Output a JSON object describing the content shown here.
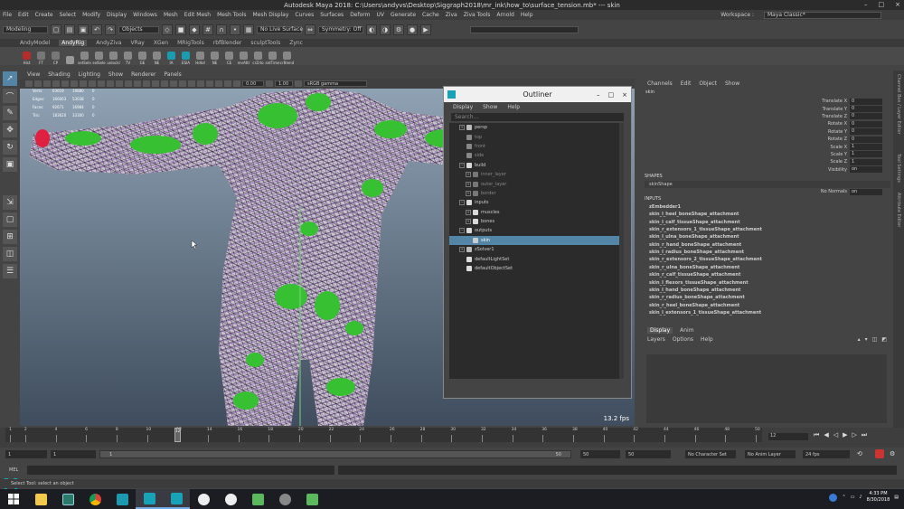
{
  "window": {
    "title": "Autodesk Maya 2018: C:\\Users\\andyvs\\Desktop\\Siggraph2018\\mr_ink\\how_to\\surface_tension.mb*   ---   skin",
    "controls": [
      "–",
      "□",
      "×"
    ]
  },
  "menubar": {
    "items": [
      "File",
      "Edit",
      "Create",
      "Select",
      "Modify",
      "Display",
      "Windows",
      "Mesh",
      "Edit Mesh",
      "Mesh Tools",
      "Mesh Display",
      "Curves",
      "Surfaces",
      "Deform",
      "UV",
      "Generate",
      "Cache",
      "Ziva",
      "Ziva Tools",
      "Arnold",
      "Help"
    ],
    "workspace_label": "Workspace :",
    "workspace_value": "Maya Classic*"
  },
  "statusline": {
    "mode": "Modeling",
    "select_mode": "Objects",
    "live_surface": "No Live Surface",
    "symmetry": "Symmetry: Off"
  },
  "shelf": {
    "tabs": [
      "AndyModel",
      "AndyRig",
      "AndyZiva",
      "VRay",
      "XGen",
      "MRigTools",
      "rbfBlender",
      "sculptTools",
      "Zync"
    ],
    "active": "AndyRig",
    "icons": [
      {
        "label": "Hist",
        "color": "#b32d2d"
      },
      {
        "label": "FT",
        "color": "#777"
      },
      {
        "label": "CP",
        "color": "#777"
      },
      {
        "label": "",
        "color": "#999"
      },
      {
        "label": "setSele",
        "color": "#888"
      },
      {
        "label": "selSele",
        "color": "#888"
      },
      {
        "label": "unlockl",
        "color": "#888"
      },
      {
        "label": "TV",
        "color": "#888"
      },
      {
        "label": "GE",
        "color": "#888"
      },
      {
        "label": "NE",
        "color": "#888"
      },
      {
        "label": "IA",
        "color": "#1b9ab0"
      },
      {
        "label": "ESIA",
        "color": "#1b9ab0"
      },
      {
        "label": "Hdkd",
        "color": "#888"
      },
      {
        "label": "NE",
        "color": "#888"
      },
      {
        "label": "CE",
        "color": "#888"
      },
      {
        "label": "revAttr",
        "color": "#888"
      },
      {
        "label": "crZrto",
        "color": "#888"
      },
      {
        "label": "setTime",
        "color": "#888"
      },
      {
        "label": "crBlend",
        "color": "#888"
      }
    ]
  },
  "viewport": {
    "menu": [
      "View",
      "Shading",
      "Lighting",
      "Show",
      "Renderer",
      "Panels"
    ],
    "exposure": "0.00",
    "gamma": "1.00",
    "colorspace": "sRGB gamma",
    "fps": "13.2 fps",
    "hud": [
      [
        "Verts:",
        "63619",
        "19880",
        "0"
      ],
      [
        "Edges:",
        "166063",
        "53038",
        "0"
      ],
      [
        "Faces:",
        "92671",
        "16984",
        "0"
      ],
      [
        "Tris:",
        "183620",
        "33300",
        "0"
      ]
    ]
  },
  "outliner": {
    "title": "Outliner",
    "menu": [
      "Display",
      "Show",
      "Help"
    ],
    "search_placeholder": "Search...",
    "controls": [
      "–",
      "□",
      "×"
    ],
    "rows": [
      {
        "label": "persp",
        "indent": 1,
        "expand": "+",
        "icon": "#bbb",
        "style": "normal"
      },
      {
        "label": "top",
        "indent": 1,
        "expand": "",
        "icon": "#888",
        "style": "dim"
      },
      {
        "label": "front",
        "indent": 1,
        "expand": "",
        "icon": "#888",
        "style": "dim"
      },
      {
        "label": "side",
        "indent": 1,
        "expand": "",
        "icon": "#888",
        "style": "dim"
      },
      {
        "label": "build",
        "indent": 1,
        "expand": "−",
        "icon": "#d9d9d9",
        "style": "normal"
      },
      {
        "label": "inner_layer",
        "indent": 2,
        "expand": "+",
        "icon": "#777",
        "style": "dim"
      },
      {
        "label": "outer_layer",
        "indent": 2,
        "expand": "+",
        "icon": "#777",
        "style": "dim"
      },
      {
        "label": "border",
        "indent": 2,
        "expand": "+",
        "icon": "#777",
        "style": "dim"
      },
      {
        "label": "inputs",
        "indent": 1,
        "expand": "−",
        "icon": "#d9d9d9",
        "style": "normal"
      },
      {
        "label": "muscles",
        "indent": 2,
        "expand": "+",
        "icon": "#d9d9d9",
        "style": "normal"
      },
      {
        "label": "bones",
        "indent": 2,
        "expand": "+",
        "icon": "#d9d9d9",
        "style": "normal"
      },
      {
        "label": "outputs",
        "indent": 1,
        "expand": "−",
        "icon": "#d9d9d9",
        "style": "normal"
      },
      {
        "label": "skin",
        "indent": 2,
        "expand": "",
        "icon": "#ccc",
        "style": "highlight"
      },
      {
        "label": "zSolver1",
        "indent": 1,
        "expand": "+",
        "icon": "#bbb",
        "style": "normal"
      },
      {
        "label": "defaultLightSet",
        "indent": 1,
        "expand": "",
        "icon": "#ddd",
        "style": "normal"
      },
      {
        "label": "defaultObjectSet",
        "indent": 1,
        "expand": "",
        "icon": "#ddd",
        "style": "normal"
      }
    ]
  },
  "channelbox": {
    "menu": [
      "Channels",
      "Edit",
      "Object",
      "Show"
    ],
    "object": "skin",
    "attrs": [
      {
        "label": "Translate X",
        "value": "0"
      },
      {
        "label": "Translate Y",
        "value": "0"
      },
      {
        "label": "Translate Z",
        "value": "0"
      },
      {
        "label": "Rotate X",
        "value": "0"
      },
      {
        "label": "Rotate Y",
        "value": "0"
      },
      {
        "label": "Rotate Z",
        "value": "0"
      },
      {
        "label": "Scale X",
        "value": "1"
      },
      {
        "label": "Scale Y",
        "value": "1"
      },
      {
        "label": "Scale Z",
        "value": "1"
      },
      {
        "label": "Visibility",
        "value": "on"
      }
    ],
    "shapes_label": "SHAPES",
    "shape_name": "skinShape",
    "no_normals_label": "No Normals",
    "no_normals_value": "on",
    "inputs_label": "INPUTS",
    "inputs": [
      "zEmbedder1",
      "skin_l_heel_boneShape_attachment",
      "skin_l_calf_tissueShape_attachment",
      "skin_r_extensors_1_tissueShape_attachment",
      "skin_l_ulna_boneShape_attachment",
      "skin_r_hand_boneShape_attachment",
      "skin_l_radius_boneShape_attachment",
      "skin_r_extensors_2_tissueShape_attachment",
      "skin_r_ulna_boneShape_attachment",
      "skin_r_calf_tissueShape_attachment",
      "skin_l_flexors_tissueShape_attachment",
      "skin_l_hand_boneShape_attachment",
      "skin_r_radius_boneShape_attachment",
      "skin_r_heel_boneShape_attachment",
      "skin_l_extensors_1_tissueShape_attachment"
    ],
    "side_tabs": [
      "Channel Box / Layer Editor",
      "Tool Settings",
      "Attribute Editor"
    ]
  },
  "layers": {
    "tabs": [
      "Display",
      "Anim"
    ],
    "menu": [
      "Layers",
      "Options",
      "Help"
    ]
  },
  "timeline": {
    "ticks": [
      "1",
      "2",
      "4",
      "6",
      "8",
      "10",
      "12",
      "14",
      "16",
      "18",
      "20",
      "22",
      "24",
      "26",
      "28",
      "30",
      "32",
      "34",
      "36",
      "38",
      "40",
      "42",
      "44",
      "46",
      "48",
      "50"
    ],
    "playhead": "12",
    "current_frame": "12"
  },
  "range": {
    "start": "1",
    "start2": "1",
    "slider_start": "1",
    "slider_end": "50",
    "end": "50",
    "end2": "50",
    "char_set": "No Character Set",
    "anim_layer": "No Anim Layer",
    "fps": "24 fps"
  },
  "mel": {
    "label": "MEL"
  },
  "helpline": {
    "text": "Select Tool: select an object"
  },
  "taskbar": {
    "time": "4:33 PM",
    "date": "8/30/2018"
  }
}
